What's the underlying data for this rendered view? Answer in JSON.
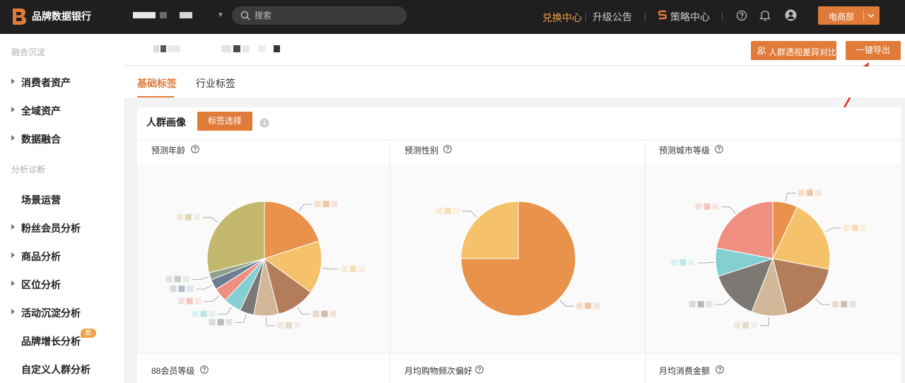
{
  "topbar": {
    "brand": "品牌数据银行",
    "search_placeholder": "搜索",
    "nav": {
      "exchange_center": "兑换中心",
      "upgrade_notice": "升级公告",
      "strategy_center": "策略中心"
    },
    "department": "电商部",
    "accent": "#e07b39",
    "highlight": "#f0a24a"
  },
  "sidebar": {
    "sections": [
      {
        "label": "融合沉淀"
      },
      {
        "label": "分析诊断"
      }
    ],
    "items": [
      {
        "label": "消费者资产",
        "expandable": true
      },
      {
        "label": "全域资产",
        "expandable": true
      },
      {
        "label": "数据融合",
        "expandable": true
      },
      {
        "label": "场景运营",
        "expandable": false
      },
      {
        "label": "粉丝会员分析",
        "expandable": true
      },
      {
        "label": "商品分析",
        "expandable": true
      },
      {
        "label": "区位分析",
        "expandable": true
      },
      {
        "label": "活动沉淀分析",
        "expandable": true
      },
      {
        "label": "品牌增长分析",
        "expandable": false,
        "badge": "新"
      },
      {
        "label": "自定义人群分析",
        "expandable": false
      }
    ]
  },
  "header": {
    "compare_button": "人群透视差异对比",
    "export_button": "一键导出"
  },
  "tabs": [
    {
      "label": "基础标签",
      "active": true
    },
    {
      "label": "行业标签",
      "active": false
    }
  ],
  "panel": {
    "title": "人群画像",
    "tag_select_button": "标签选择",
    "cells": [
      {
        "title": "预测年龄"
      },
      {
        "title": "预测性别"
      },
      {
        "title": "预测城市等级"
      },
      {
        "title": "88会员等级"
      },
      {
        "title": "月均购物频次偏好"
      },
      {
        "title": "月均消费金额"
      }
    ]
  },
  "chart_data": [
    {
      "type": "pie",
      "title": "预测年龄",
      "values": [
        20,
        15,
        11,
        7,
        4,
        5,
        4,
        3,
        2,
        29
      ],
      "colors": [
        "#e8924b",
        "#f5c26b",
        "#b37c5a",
        "#d2b899",
        "#7d7874",
        "#84cfd1",
        "#ef8f82",
        "#6a7d93",
        "#8ea18a",
        "#c4b86e"
      ]
    },
    {
      "type": "pie",
      "title": "预测性别",
      "values": [
        75,
        25
      ],
      "colors": [
        "#e8924b",
        "#f5c26b"
      ]
    },
    {
      "type": "pie",
      "title": "预测城市等级",
      "values": [
        7,
        21,
        18,
        10,
        14,
        8,
        22
      ],
      "colors": [
        "#e8924b",
        "#f5c26b",
        "#b37c5a",
        "#d2b899",
        "#7d7874",
        "#84cfd1",
        "#ef8f82"
      ]
    }
  ]
}
